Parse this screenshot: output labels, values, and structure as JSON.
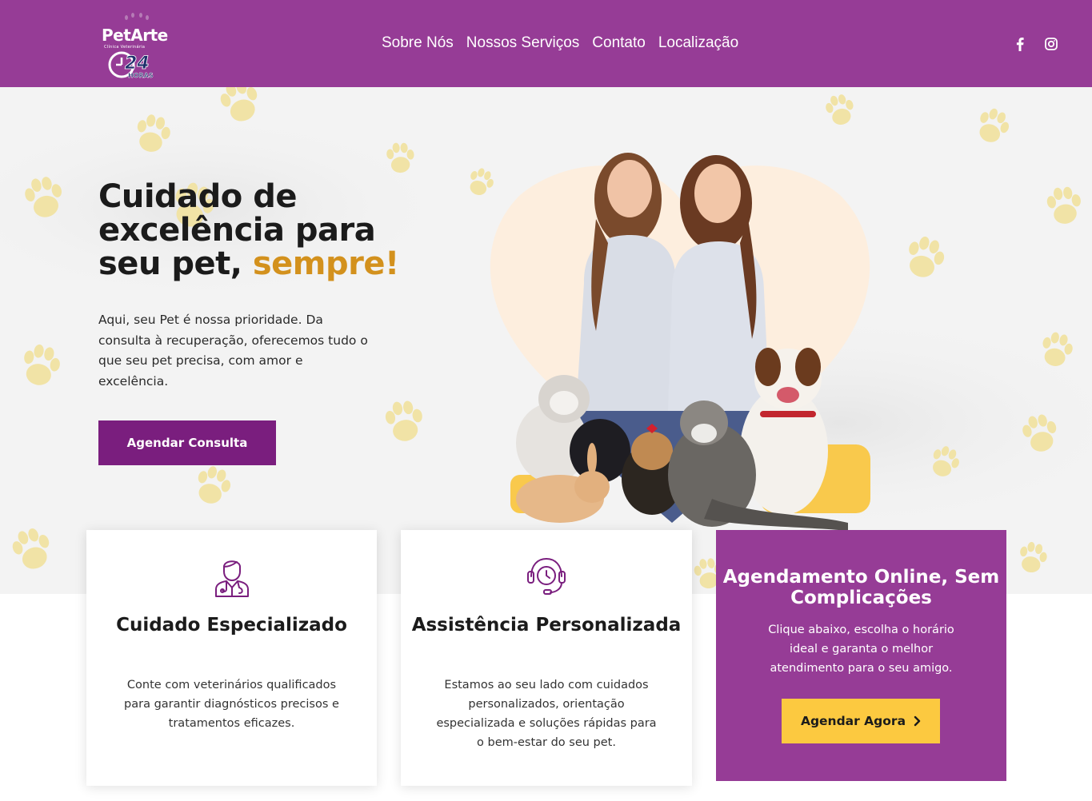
{
  "header": {
    "logo": {
      "brand": "PetArte",
      "subtitle": "Clínica Veterinária",
      "badge_number": "24",
      "badge_text": "HORAS"
    },
    "nav": [
      "Sobre Nós",
      "Nossos Serviços",
      "Contato",
      "Localização"
    ],
    "social": [
      {
        "icon": "facebook-icon"
      },
      {
        "icon": "instagram-icon"
      }
    ]
  },
  "hero": {
    "title_part1": "Cuidado de excelência para seu pet,",
    "title_accent": "sempre!",
    "description": "Aqui, seu Pet é nossa prioridade. Da consulta à recuperação, oferecemos tudo o que seu pet precisa, com amor e excelência.",
    "cta_label": "Agendar Consulta"
  },
  "cards": [
    {
      "icon": "veterinarian-icon",
      "title": "Cuidado Especializado",
      "text": "Conte com veterinários qualificados para garantir diagnósticos precisos e tratamentos eficazes."
    },
    {
      "icon": "headset-clock-icon",
      "title": "Assistência Personalizada",
      "text": "Estamos ao seu lado com cuidados personalizados, orientação especializada e soluções rápidas para o bem-estar do seu pet."
    }
  ],
  "booking": {
    "title": "Agendamento Online, Sem Complicações",
    "text": "Clique abaixo, escolha o horário ideal e garanta o melhor atendimento para o seu amigo.",
    "cta_label": "Agendar Agora"
  },
  "colors": {
    "brand_purple": "#963c96",
    "button_purple": "#7a1e7e",
    "accent_gold": "#d3911d",
    "button_yellow": "#fcc940",
    "paw_yellow": "#f1e3a6"
  }
}
